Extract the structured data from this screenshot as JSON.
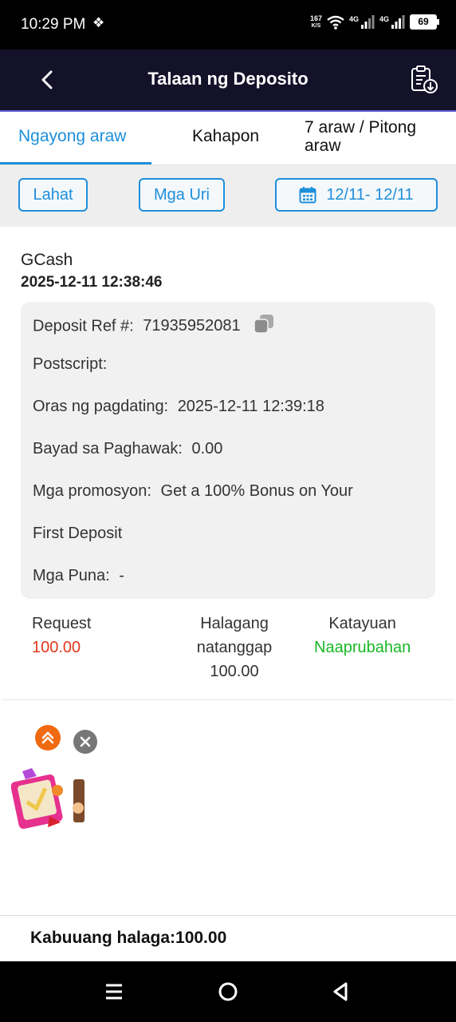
{
  "status_bar": {
    "time": "10:29 PM",
    "notification_icons": "❖",
    "speed_value": "167",
    "speed_unit": "K/S",
    "net1": "4G",
    "net2": "4G",
    "battery": "69"
  },
  "header": {
    "title": "Talaan ng Deposito",
    "back_icon": "chevron-left-icon",
    "action_icon": "clipboard-download-icon"
  },
  "tabs": [
    {
      "label": "Ngayong araw",
      "active": true
    },
    {
      "label": "Kahapon",
      "active": false
    },
    {
      "label": "7 araw / Pitong araw",
      "active": false
    }
  ],
  "filters": {
    "all_label": "Lahat",
    "types_label": "Mga Uri",
    "date_range": "12/11- 12/11",
    "date_icon": "calendar-icon"
  },
  "record": {
    "method": "GCash",
    "datetime": "2025-12-11 12:38:46",
    "details": {
      "ref_label": "Deposit Ref #:",
      "ref_value": "71935952081",
      "postscript_label": "Postscript:",
      "postscript_value": "",
      "arrival_label": "Oras ng pagdating:",
      "arrival_value": "2025-12-11 12:39:18",
      "fee_label": "Bayad sa Paghawak:",
      "fee_value": "0.00",
      "promo_label": "Mga promosyon:",
      "promo_value_line1": "Get a 100% Bonus on Your",
      "promo_value_line2": "First Deposit",
      "remarks_label": "Mga Puna:",
      "remarks_value": "-"
    },
    "summary": {
      "request_label": "Request",
      "request_value": "100.00",
      "received_label_line1": "Halagang",
      "received_label_line2": "natanggap",
      "received_value": "100.00",
      "status_label": "Katayuan",
      "status_value": "Naaprubahan"
    }
  },
  "total": {
    "text": "Kabuuang halaga:100.00"
  },
  "colors": {
    "accent": "#1e8fdb",
    "header_bg": "#141229",
    "request_value": "#e0381b",
    "status_approved": "#17b826"
  }
}
